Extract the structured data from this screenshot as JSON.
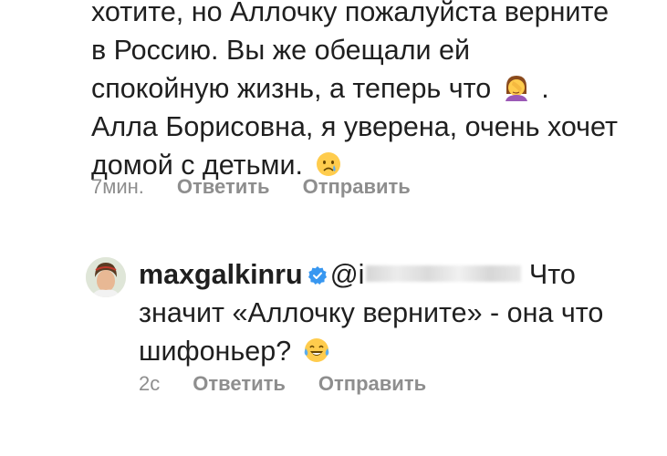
{
  "comment1": {
    "line1": "хотите, но Аллочку пожалуйста верните",
    "line2": "в Россию. Вы же обещали ей",
    "line3": "спокойную жизнь, а теперь что",
    "line3_end": ".",
    "line4": "Алла Борисовна, я уверена, очень хочет",
    "line5": "домой с детьми.",
    "emoji_1": "face-palm-emoji",
    "emoji_2": "crying-face-emoji",
    "time": "7мин.",
    "reply_label": "Ответить",
    "send_label": "Отправить"
  },
  "comment2": {
    "username": "maxgalkinru",
    "verified_icon": "verified-badge-icon",
    "mention_prefix": "@i",
    "text_line1_end": "Что",
    "text_line2": "значит «Аллочку верните» - она что",
    "text_line3": "шифоньер?",
    "emoji": "tears-of-joy-emoji",
    "time": "2с",
    "reply_label": "Ответить",
    "send_label": "Отправить"
  },
  "colors": {
    "text": "#1f1f1f",
    "meta": "#8e8e8e",
    "verified": "#3897f0"
  }
}
